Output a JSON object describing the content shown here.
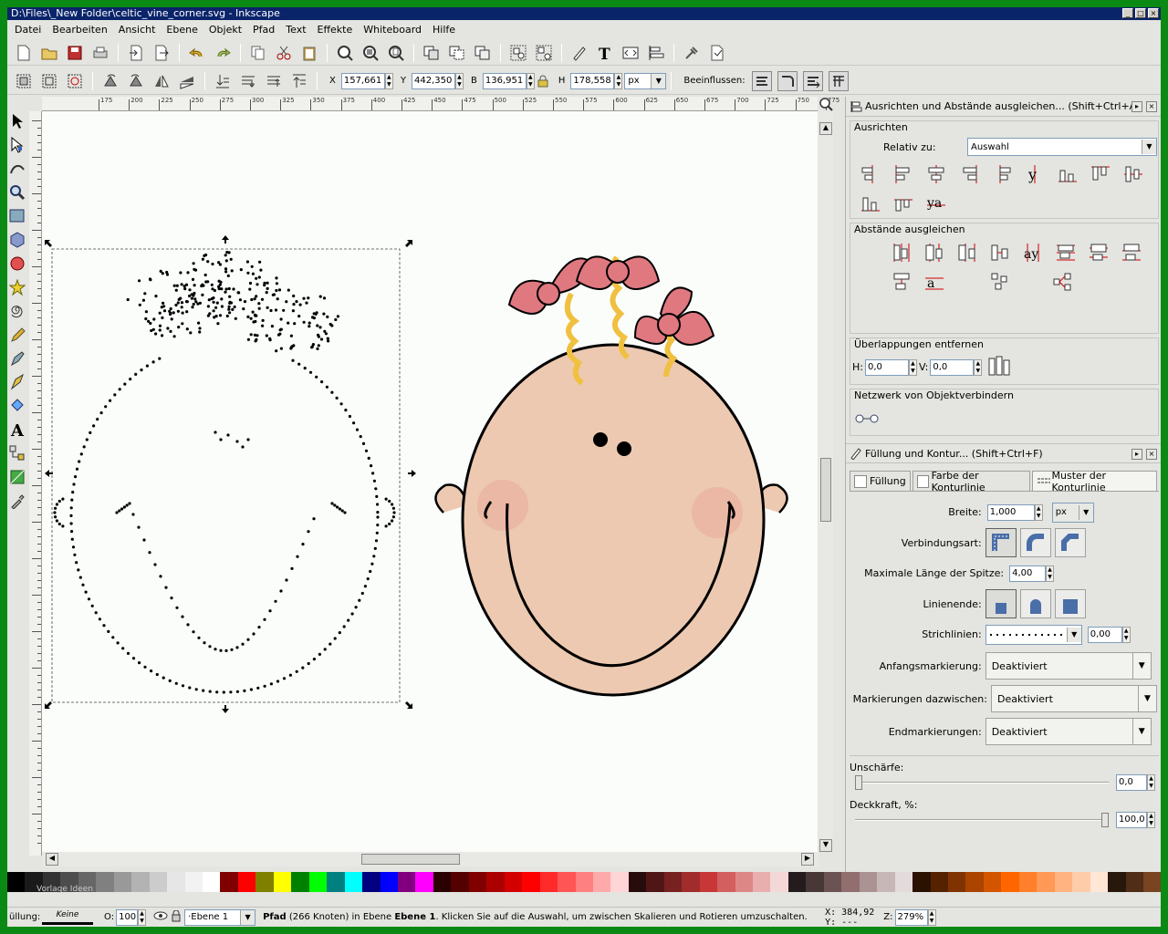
{
  "window": {
    "title": "D:\\Files\\_New Folder\\celtic_vine_corner.svg - Inkscape",
    "controls": [
      "_",
      "□",
      "×"
    ]
  },
  "menubar": [
    {
      "label": "Datei"
    },
    {
      "label": "Bearbeiten"
    },
    {
      "label": "Ansicht"
    },
    {
      "label": "Ebene"
    },
    {
      "label": "Objekt"
    },
    {
      "label": "Pfad"
    },
    {
      "label": "Text"
    },
    {
      "label": "Effekte"
    },
    {
      "label": "Whiteboard"
    },
    {
      "label": "Hilfe"
    }
  ],
  "commands_toolbar": [
    "new-document-icon",
    "open-icon",
    "save-icon",
    "print-icon",
    "import-icon",
    "export-icon",
    "undo-icon",
    "redo-icon",
    "copy-icon",
    "cut-icon",
    "paste-icon",
    "zoom-selection-icon",
    "zoom-drawing-icon",
    "zoom-page-icon",
    "duplicate-icon",
    "clone-icon",
    "unlink-clone-icon",
    "group-icon",
    "ungroup-icon",
    "fill-stroke-icon",
    "text-tool-icon",
    "xml-editor-icon",
    "align-icon",
    "preferences-icon",
    "document-properties-icon"
  ],
  "selector_toolbar": {
    "x_label": "X",
    "x_value": "157,661",
    "y_label": "Y",
    "y_value": "442,350",
    "w_label": "B",
    "w_value": "136,951",
    "h_label": "H",
    "h_value": "178,558",
    "unit": "px",
    "affect_label": "Beeinflussen:"
  },
  "tools": [
    "selector-tool-icon",
    "node-tool-icon",
    "tweak-tool-icon",
    "zoom-tool-icon",
    "rectangle-tool-icon",
    "3d-box-tool-icon",
    "ellipse-tool-icon",
    "star-tool-icon",
    "spiral-tool-icon",
    "pencil-tool-icon",
    "pen-tool-icon",
    "calligraphy-tool-icon",
    "paint-bucket-tool-icon",
    "text-tool-icon",
    "connector-tool-icon",
    "gradient-tool-icon",
    "dropper-tool-icon"
  ],
  "ruler": {
    "h_ticks": [
      "175",
      "200",
      "225",
      "250",
      "275",
      "300",
      "325",
      "350",
      "375",
      "400",
      "425",
      "450",
      "475",
      "500",
      "525",
      "550",
      "575",
      "600",
      "625",
      "650",
      "675",
      "700",
      "725",
      "750",
      "775"
    ]
  },
  "align_panel": {
    "title": "Ausrichten und Abstände ausgleichen... (Shift+Ctrl+A)",
    "align_section": "Ausrichten",
    "relative_label": "Relativ zu:",
    "relative_value": "Auswahl",
    "distribute_section": "Abstände ausgleichen",
    "overlap_section": "Überlappungen entfernen",
    "overlap_h_label": "H:",
    "overlap_h": "0,0",
    "overlap_v_label": "V:",
    "overlap_v": "0,0",
    "connector_section": "Netzwerk von Objektverbindern"
  },
  "fill_stroke_panel": {
    "title": "Füllung und Kontur... (Shift+Ctrl+F)",
    "tabs": [
      {
        "label": "Füllung"
      },
      {
        "label": "Farbe der Konturlinie"
      },
      {
        "label": "Muster der Konturlinie"
      }
    ],
    "width_label": "Breite:",
    "width_value": "1,000",
    "width_unit": "px",
    "join_label": "Verbindungsart:",
    "miter_label": "Maximale Länge der Spitze:",
    "miter_value": "4,00",
    "cap_label": "Linienende:",
    "dash_label": "Strichlinien:",
    "dash_offset": "0,00",
    "start_marker_label": "Anfangsmarkierung:",
    "start_marker_value": "Deaktiviert",
    "mid_marker_label": "Markierungen dazwischen:",
    "mid_marker_value": "Deaktiviert",
    "end_marker_label": "Endmarkierungen:",
    "end_marker_value": "Deaktiviert",
    "blur_label": "Unschärfe:",
    "blur_value": "0,0",
    "opacity_label": "Deckkraft, %:",
    "opacity_value": "100,0"
  },
  "palette": {
    "watermark": "Vorlage Ideen",
    "colors": [
      "#000000",
      "#1a1a1a",
      "#333333",
      "#4d4d4d",
      "#666666",
      "#808080",
      "#999999",
      "#b3b3b3",
      "#cccccc",
      "#e6e6e6",
      "#f2f2f2",
      "#ffffff",
      "#800000",
      "#ff0000",
      "#808000",
      "#ffff00",
      "#008000",
      "#00ff00",
      "#008080",
      "#00ffff",
      "#000080",
      "#0000ff",
      "#800080",
      "#ff00ff",
      "#2b0000",
      "#550000",
      "#800000",
      "#aa0000",
      "#d40000",
      "#ff0000",
      "#ff2a2a",
      "#ff5555",
      "#ff8080",
      "#ffaaaa",
      "#ffd5d5",
      "#280b0b",
      "#501616",
      "#782121",
      "#a02c2c",
      "#c83737",
      "#d35f5f",
      "#de8787",
      "#e9afaf",
      "#f4d7d7",
      "#241c1c",
      "#483737",
      "#6c5353",
      "#916f6f",
      "#ac9393",
      "#c8b7b7",
      "#e3dbdb",
      "#2b1100",
      "#552200",
      "#803300",
      "#aa4400",
      "#d45500",
      "#ff6600",
      "#ff7f2a",
      "#ff9955",
      "#ffb380",
      "#ffccaa",
      "#ffe6d5",
      "#28170b",
      "#502d16",
      "#784421"
    ]
  },
  "statusbar": {
    "fill_label": "üllung:",
    "stroke_value": "Keine",
    "opacity_label": "O:",
    "opacity_value": "100",
    "layer": "·Ebene 1",
    "message_bold": "Pfad",
    "message": " (266 Knoten) in Ebene ",
    "message_layer": "Ebene 1",
    "message_tail": ". Klicken Sie auf die Auswahl, um zwischen Skalieren und Rotieren umzuschalten.",
    "x_label": "X:",
    "x_value": "384,92",
    "y_label": "Y:",
    "y_value": "---",
    "zoom_label": "Z:",
    "zoom_value": "279%"
  }
}
